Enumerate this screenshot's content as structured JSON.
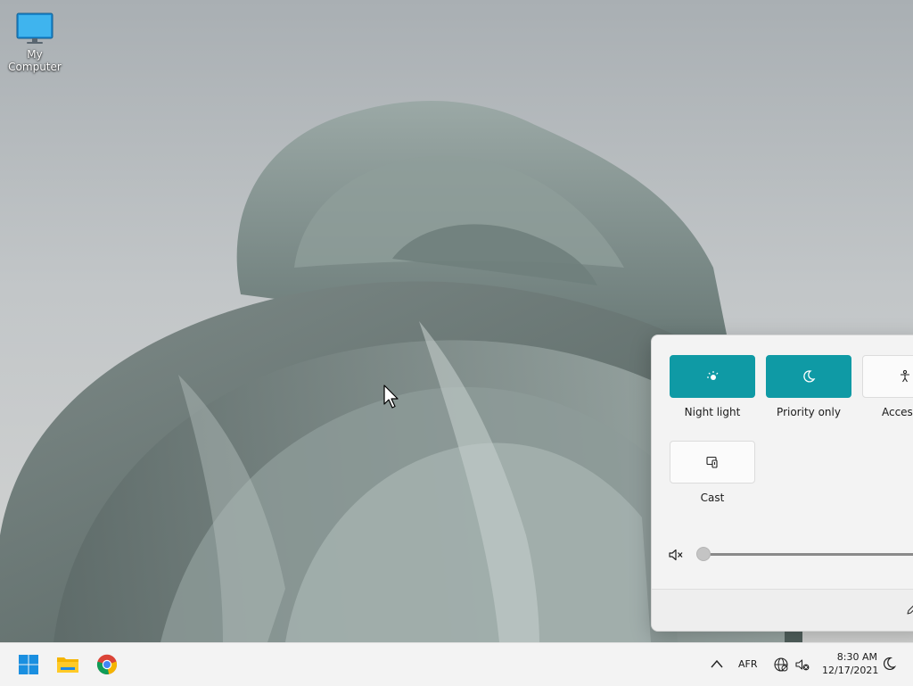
{
  "desktop": {
    "icons": [
      {
        "label": "My Computer",
        "icon": "monitor-icon"
      }
    ]
  },
  "quick_settings": {
    "tiles": [
      {
        "label": "Night light",
        "icon": "night-light-icon",
        "active": true
      },
      {
        "label": "Priority only",
        "icon": "moon-icon",
        "active": true
      },
      {
        "label": "Accessib",
        "icon": "accessibility-icon",
        "active": false
      },
      {
        "label": "Cast",
        "icon": "cast-icon",
        "active": false
      }
    ],
    "volume": {
      "icon": "volume-muted-icon",
      "level": 0
    },
    "footer": {
      "edit_icon": "pencil-icon"
    }
  },
  "taskbar": {
    "apps": [
      {
        "name": "Start",
        "icon": "windows-logo-icon"
      },
      {
        "name": "File Explorer",
        "icon": "folder-icon"
      },
      {
        "name": "Google Chrome",
        "icon": "chrome-icon"
      }
    ],
    "tray": {
      "chevron_icon": "chevron-up-icon",
      "language": "AFR",
      "network_icon": "globe-icon",
      "volume_icon": "speaker-muted-icon",
      "time": "8:30 AM",
      "date": "12/17/2021",
      "focus_icon": "moon-icon"
    }
  },
  "colors": {
    "accent": "#0f9aa5",
    "taskbar": "#f3f3f3",
    "flyout": "#f3f3f3"
  }
}
